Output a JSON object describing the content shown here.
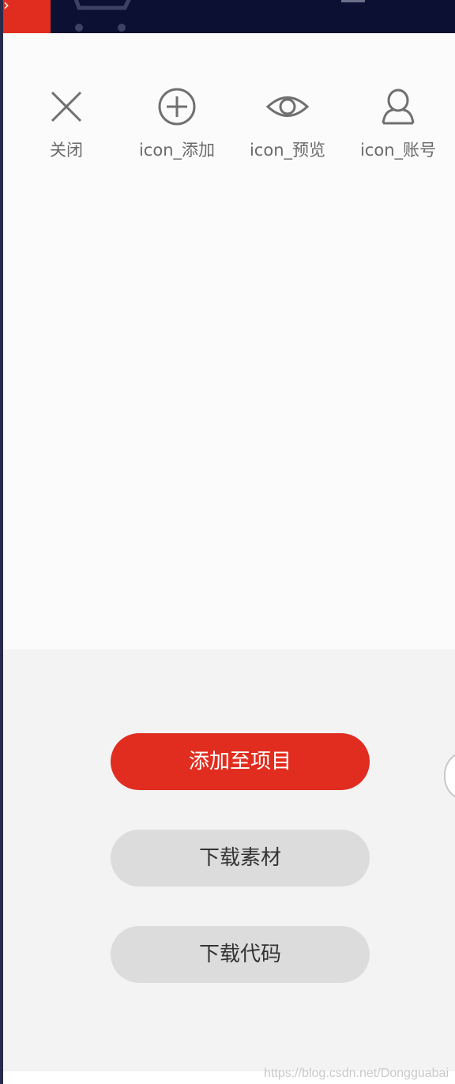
{
  "icons": [
    {
      "name": "close-icon",
      "label": "关闭"
    },
    {
      "name": "add-icon",
      "label": "icon_添加"
    },
    {
      "name": "preview-icon",
      "label": "icon_预览"
    },
    {
      "name": "account-icon",
      "label": "icon_账号"
    }
  ],
  "actions": {
    "add_to_project": "添加至项目",
    "download_asset": "下载素材",
    "download_code": "下载代码"
  },
  "watermark": "https://blog.csdn.net/Dongguabai",
  "colors": {
    "accent": "#e12d1f",
    "topbar": "#0c1032",
    "secondary_button": "#dcdcdc",
    "icon_gray": "#707070"
  }
}
